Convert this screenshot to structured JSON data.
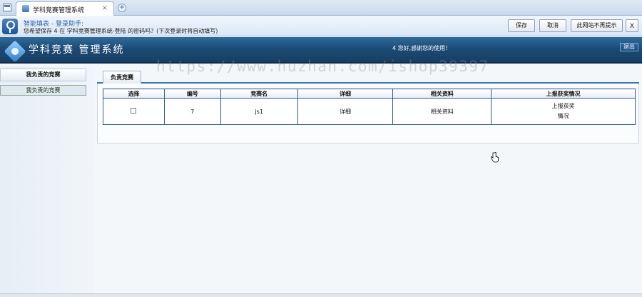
{
  "browser": {
    "tab_title": "学科竞赛管理系统",
    "tab_close": "×",
    "new_tab": "+"
  },
  "autofill": {
    "title": "智能填表 - 登录助手:",
    "message": "您希望保存 4 在 学科竞赛管理系统-登陆 的密码吗？(下次登录时将自动填写)",
    "save": "保存",
    "cancel": "取消",
    "never": "此网站不再提示",
    "close": "X"
  },
  "header": {
    "title": "学科竞赛 管理系统",
    "welcome": "4 您好,感谢您的使用！",
    "logout": "退出"
  },
  "sidebar": {
    "heading": "我负责的竞赛",
    "items": [
      {
        "label": "我负责的竞赛"
      }
    ]
  },
  "main": {
    "tab": "负责竞赛",
    "columns": [
      "选择",
      "编号",
      "竞赛名",
      "详细",
      "相关资料",
      "上报获奖情况"
    ],
    "rows": [
      {
        "id": "7",
        "name": "js1",
        "detail": "详细",
        "materials": "相关资料",
        "report_line1": "上报获奖",
        "report_line2": "情况"
      }
    ]
  },
  "watermark": "https://www.huzhan.com/ishop39397",
  "colors": {
    "header_bg": "#1c4b76",
    "accent": "#3a78b4",
    "table_border": "#2e5d8c"
  }
}
